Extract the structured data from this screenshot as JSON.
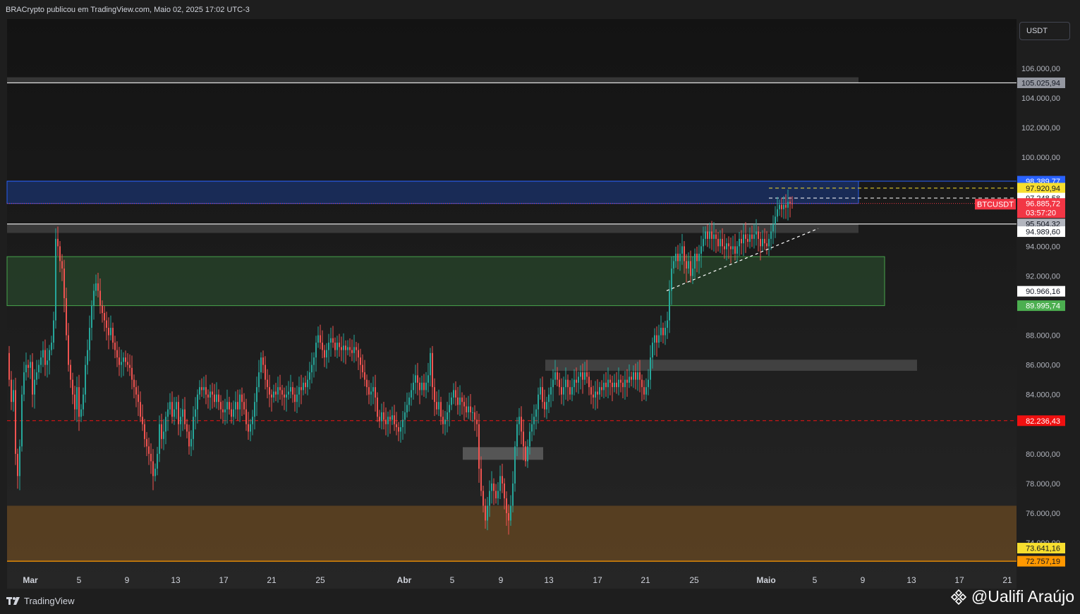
{
  "header": {
    "published_text": "BRACrypto publicou em TradingView.com, Maio 02, 2025 17:02 UTC-3"
  },
  "currency_button": "USDT",
  "footer": {
    "brand": "TradingView",
    "watermark": "@Ualifi Araújo"
  },
  "chart_data": {
    "type": "candlestick",
    "symbol": "BTCUSDT",
    "ylim": [
      72000,
      107600
    ],
    "y_ticks": [
      "106.000,00",
      "104.000,00",
      "102.000,00",
      "100.000,00",
      "94.000,00",
      "92.000,00",
      "88.000,00",
      "86.000,00",
      "84.000,00",
      "80.000,00",
      "78.000,00",
      "76.000,00",
      "74.000,00"
    ],
    "x_ticks": [
      "Mar",
      "5",
      "9",
      "13",
      "17",
      "21",
      "25",
      "Abr",
      "5",
      "9",
      "13",
      "17",
      "21",
      "25",
      "Maio",
      "5",
      "9",
      "13",
      "17",
      "21"
    ],
    "price_labels": [
      {
        "text": "105.025,94",
        "value": 105025.94,
        "bg": "#9598a1",
        "fg": "#131722"
      },
      {
        "text": "98.389,77",
        "value": 98389.77,
        "bg": "#2962ff",
        "fg": "#ffffff"
      },
      {
        "text": "97.920,94",
        "value": 97920.94,
        "bg": "#f7de2f",
        "fg": "#131722"
      },
      {
        "text": "97.248,58",
        "value": 97248.58,
        "bg": "#ffffff",
        "fg": "#131722"
      },
      {
        "text": "96.885,72",
        "value": 96885.72,
        "bg": "#f23645",
        "fg": "#ffffff"
      },
      {
        "text": "95.504,32",
        "value": 95504.32,
        "bg": "#b2b5be",
        "fg": "#131722"
      },
      {
        "text": "94.989,60",
        "value": 94989.6,
        "bg": "#ffffff",
        "fg": "#131722"
      },
      {
        "text": "90.966,16",
        "value": 90966.16,
        "bg": "#ffffff",
        "fg": "#131722"
      },
      {
        "text": "89.995,74",
        "value": 89995.74,
        "bg": "#4caf50",
        "fg": "#ffffff"
      },
      {
        "text": "82.236,43",
        "value": 82236.43,
        "bg": "#f01010",
        "fg": "#ffffff"
      },
      {
        "text": "73.641,16",
        "value": 73641.16,
        "bg": "#f7de2f",
        "fg": "#131722"
      },
      {
        "text": "72.757,19",
        "value": 72757.19,
        "bg": "#ff9800",
        "fg": "#131722"
      }
    ],
    "countdown": "03:57:20",
    "zones": [
      {
        "name": "resistance-zone",
        "from": 105400,
        "to": 105025.94,
        "color": "#3a3a3a"
      },
      {
        "name": "blue-zone",
        "from": 98389.77,
        "to": 96885.72,
        "color": "#1a2d5c"
      },
      {
        "name": "grey-zone",
        "from": 95504.32,
        "to": 94900,
        "color": "#3c3c3c"
      },
      {
        "name": "green-zone",
        "from": 93300,
        "to": 89995.74,
        "color": "#253d28"
      },
      {
        "name": "supply-zone",
        "from": 86350,
        "to": 85600,
        "color": "#444444"
      },
      {
        "name": "low-zone",
        "from": 80450,
        "to": 79600,
        "color": "#5a5a5a"
      },
      {
        "name": "brown-zone",
        "from": 76500,
        "to": 72757.19,
        "color": "#5b4122"
      }
    ],
    "series_close": [
      [
        0,
        86800
      ],
      [
        3,
        85000
      ],
      [
        6,
        83500
      ],
      [
        9,
        84300
      ],
      [
        12,
        80000
      ],
      [
        15,
        78500
      ],
      [
        18,
        80500
      ],
      [
        21,
        84000
      ],
      [
        24,
        85500
      ],
      [
        27,
        86000
      ],
      [
        30,
        85800
      ],
      [
        33,
        86200
      ],
      [
        36,
        84000
      ],
      [
        39,
        85000
      ],
      [
        42,
        85500
      ],
      [
        45,
        86000
      ],
      [
        48,
        86500
      ],
      [
        51,
        87000
      ],
      [
        54,
        86000
      ],
      [
        57,
        86300
      ],
      [
        60,
        87000
      ],
      [
        63,
        87500
      ],
      [
        66,
        89000
      ],
      [
        69,
        94500
      ],
      [
        72,
        94000
      ],
      [
        75,
        93000
      ],
      [
        78,
        92500
      ],
      [
        81,
        90500
      ],
      [
        84,
        88000
      ],
      [
        87,
        86000
      ],
      [
        90,
        85000
      ],
      [
        93,
        84000
      ],
      [
        96,
        83000
      ],
      [
        99,
        84500
      ],
      [
        102,
        82500
      ],
      [
        105,
        83000
      ],
      [
        108,
        84000
      ],
      [
        111,
        86000
      ],
      [
        114,
        87000
      ],
      [
        117,
        88500
      ],
      [
        120,
        90000
      ],
      [
        123,
        91000
      ],
      [
        126,
        91500
      ],
      [
        129,
        91000
      ],
      [
        132,
        90000
      ],
      [
        135,
        89500
      ],
      [
        138,
        89000
      ],
      [
        141,
        88500
      ],
      [
        144,
        88000
      ],
      [
        147,
        88500
      ],
      [
        150,
        87500
      ],
      [
        153,
        87000
      ],
      [
        156,
        86500
      ],
      [
        159,
        86000
      ],
      [
        162,
        86200
      ],
      [
        165,
        86500
      ],
      [
        168,
        86200
      ],
      [
        171,
        86000
      ],
      [
        174,
        85800
      ],
      [
        177,
        85000
      ],
      [
        180,
        84500
      ],
      [
        183,
        84000
      ],
      [
        186,
        83500
      ],
      [
        189,
        82500
      ],
      [
        192,
        82000
      ],
      [
        195,
        81000
      ],
      [
        198,
        80500
      ],
      [
        201,
        80000
      ],
      [
        204,
        79500
      ],
      [
        207,
        78500
      ],
      [
        210,
        79000
      ],
      [
        213,
        80000
      ],
      [
        216,
        82000
      ],
      [
        219,
        81000
      ],
      [
        222,
        81500
      ],
      [
        225,
        82500
      ],
      [
        228,
        83000
      ],
      [
        231,
        83500
      ],
      [
        234,
        82500
      ],
      [
        237,
        83000
      ],
      [
        240,
        83500
      ],
      [
        243,
        82000
      ],
      [
        246,
        82500
      ],
      [
        249,
        83000
      ],
      [
        252,
        82000
      ],
      [
        255,
        81500
      ],
      [
        258,
        80500
      ],
      [
        261,
        81000
      ],
      [
        264,
        82500
      ],
      [
        267,
        83000
      ],
      [
        270,
        84000
      ],
      [
        273,
        84500
      ],
      [
        276,
        84300
      ],
      [
        279,
        84500
      ],
      [
        282,
        84000
      ],
      [
        285,
        83800
      ],
      [
        288,
        84200
      ],
      [
        291,
        84000
      ],
      [
        294,
        83500
      ],
      [
        297,
        84000
      ],
      [
        300,
        83500
      ],
      [
        303,
        83000
      ],
      [
        306,
        82800
      ],
      [
        309,
        83000
      ],
      [
        312,
        83500
      ],
      [
        315,
        83000
      ],
      [
        318,
        82500
      ],
      [
        321,
        83000
      ],
      [
        324,
        83500
      ],
      [
        327,
        83000
      ],
      [
        330,
        84000
      ],
      [
        333,
        83500
      ],
      [
        336,
        83000
      ],
      [
        339,
        82000
      ],
      [
        342,
        81500
      ],
      [
        345,
        82000
      ],
      [
        348,
        82500
      ],
      [
        351,
        83500
      ],
      [
        354,
        84500
      ],
      [
        357,
        85500
      ],
      [
        360,
        86500
      ],
      [
        363,
        86000
      ],
      [
        366,
        85000
      ],
      [
        369,
        84500
      ],
      [
        372,
        84000
      ],
      [
        375,
        83800
      ],
      [
        378,
        84200
      ],
      [
        381,
        84000
      ],
      [
        384,
        84500
      ],
      [
        387,
        84300
      ],
      [
        390,
        84000
      ],
      [
        393,
        83800
      ],
      [
        396,
        84000
      ],
      [
        399,
        84200
      ],
      [
        402,
        84500
      ],
      [
        405,
        84000
      ],
      [
        408,
        83500
      ],
      [
        411,
        84000
      ],
      [
        414,
        84500
      ],
      [
        417,
        84300
      ],
      [
        420,
        84800
      ],
      [
        423,
        84500
      ],
      [
        426,
        85000
      ],
      [
        429,
        85500
      ],
      [
        432,
        86000
      ],
      [
        435,
        86500
      ],
      [
        438,
        87500
      ],
      [
        441,
        88000
      ],
      [
        444,
        87500
      ],
      [
        447,
        87000
      ],
      [
        450,
        86500
      ],
      [
        453,
        87000
      ],
      [
        456,
        87500
      ],
      [
        459,
        87800
      ],
      [
        462,
        87500
      ],
      [
        465,
        87000
      ],
      [
        468,
        87500
      ],
      [
        471,
        87200
      ],
      [
        474,
        87000
      ],
      [
        477,
        87300
      ],
      [
        480,
        87000
      ],
      [
        483,
        87200
      ],
      [
        486,
        87000
      ],
      [
        489,
        86800
      ],
      [
        492,
        87200
      ],
      [
        495,
        87000
      ],
      [
        498,
        86500
      ],
      [
        501,
        86000
      ],
      [
        504,
        85500
      ],
      [
        507,
        85000
      ],
      [
        510,
        84500
      ],
      [
        513,
        84000
      ],
      [
        516,
        84200
      ],
      [
        519,
        84500
      ],
      [
        522,
        83800
      ],
      [
        525,
        82500
      ],
      [
        528,
        82200
      ],
      [
        531,
        82800
      ],
      [
        534,
        82300
      ],
      [
        537,
        82000
      ],
      [
        540,
        82500
      ],
      [
        543,
        82300
      ],
      [
        546,
        82600
      ],
      [
        549,
        82000
      ],
      [
        552,
        81800
      ],
      [
        555,
        81500
      ],
      [
        558,
        81800
      ],
      [
        561,
        82300
      ],
      [
        564,
        82800
      ],
      [
        567,
        83300
      ],
      [
        570,
        83800
      ],
      [
        573,
        84300
      ],
      [
        576,
        84800
      ],
      [
        579,
        85300
      ],
      [
        582,
        84800
      ],
      [
        585,
        84300
      ],
      [
        588,
        84800
      ],
      [
        591,
        84300
      ],
      [
        594,
        84800
      ],
      [
        597,
        85300
      ],
      [
        600,
        86800
      ],
      [
        603,
        84500
      ],
      [
        606,
        83500
      ],
      [
        609,
        83000
      ],
      [
        612,
        83500
      ],
      [
        615,
        82500
      ],
      [
        618,
        82000
      ],
      [
        621,
        82300
      ],
      [
        624,
        82800
      ],
      [
        627,
        83300
      ],
      [
        630,
        83800
      ],
      [
        633,
        84300
      ],
      [
        636,
        83800
      ],
      [
        639,
        83300
      ],
      [
        642,
        83800
      ],
      [
        645,
        83500
      ],
      [
        648,
        83200
      ],
      [
        651,
        82800
      ],
      [
        654,
        83200
      ],
      [
        657,
        82800
      ],
      [
        660,
        82800
      ],
      [
        663,
        82300
      ],
      [
        666,
        82000
      ],
      [
        669,
        79000
      ],
      [
        672,
        77500
      ],
      [
        675,
        76500
      ],
      [
        678,
        75500
      ],
      [
        681,
        76500
      ],
      [
        684,
        77500
      ],
      [
        687,
        78000
      ],
      [
        690,
        77500
      ],
      [
        693,
        77000
      ],
      [
        696,
        77500
      ],
      [
        699,
        78500
      ],
      [
        702,
        78000
      ],
      [
        705,
        77000
      ],
      [
        708,
        76000
      ],
      [
        711,
        75500
      ],
      [
        714,
        76500
      ],
      [
        717,
        78000
      ],
      [
        720,
        80500
      ],
      [
        723,
        82000
      ],
      [
        726,
        82500
      ],
      [
        729,
        81500
      ],
      [
        732,
        80500
      ],
      [
        735,
        79500
      ],
      [
        738,
        80500
      ],
      [
        741,
        81500
      ],
      [
        744,
        82000
      ],
      [
        747,
        82500
      ],
      [
        750,
        83000
      ],
      [
        753,
        84000
      ],
      [
        756,
        84500
      ],
      [
        759,
        83500
      ],
      [
        762,
        83000
      ],
      [
        765,
        83500
      ],
      [
        768,
        84000
      ],
      [
        771,
        84500
      ],
      [
        774,
        85000
      ],
      [
        777,
        85500
      ],
      [
        780,
        85000
      ],
      [
        783,
        84500
      ],
      [
        786,
        84000
      ],
      [
        789,
        84500
      ],
      [
        792,
        85000
      ],
      [
        795,
        84500
      ],
      [
        798,
        84000
      ],
      [
        801,
        84500
      ],
      [
        804,
        85000
      ],
      [
        807,
        84800
      ],
      [
        810,
        85200
      ],
      [
        813,
        85500
      ],
      [
        816,
        85000
      ],
      [
        819,
        85500
      ],
      [
        822,
        85200
      ],
      [
        825,
        84500
      ],
      [
        828,
        84000
      ],
      [
        831,
        83800
      ],
      [
        834,
        84200
      ],
      [
        837,
        84000
      ],
      [
        840,
        84500
      ],
      [
        843,
        84300
      ],
      [
        846,
        84800
      ],
      [
        849,
        84500
      ],
      [
        852,
        85000
      ],
      [
        855,
        84800
      ],
      [
        858,
        84500
      ],
      [
        861,
        84800
      ],
      [
        864,
        84500
      ],
      [
        867,
        85000
      ],
      [
        870,
        84800
      ],
      [
        873,
        84500
      ],
      [
        876,
        85000
      ],
      [
        879,
        84800
      ],
      [
        882,
        85200
      ],
      [
        885,
        85000
      ],
      [
        888,
        85500
      ],
      [
        891,
        85000
      ],
      [
        894,
        85500
      ],
      [
        897,
        85000
      ],
      [
        900,
        84500
      ],
      [
        903,
        84000
      ],
      [
        906,
        84500
      ],
      [
        909,
        85000
      ],
      [
        912,
        86500
      ],
      [
        915,
        87500
      ],
      [
        918,
        88000
      ],
      [
        921,
        87500
      ],
      [
        924,
        88000
      ],
      [
        927,
        88500
      ],
      [
        930,
        88000
      ],
      [
        933,
        88500
      ],
      [
        936,
        89000
      ],
      [
        939,
        91000
      ],
      [
        942,
        92500
      ],
      [
        945,
        93000
      ],
      [
        948,
        93500
      ],
      [
        951,
        93000
      ],
      [
        954,
        93500
      ],
      [
        957,
        94000
      ],
      [
        960,
        93000
      ],
      [
        963,
        92500
      ],
      [
        966,
        93000
      ],
      [
        969,
        92000
      ],
      [
        972,
        92500
      ],
      [
        975,
        93500
      ],
      [
        978,
        93000
      ],
      [
        981,
        93500
      ],
      [
        984,
        94000
      ],
      [
        987,
        94500
      ],
      [
        990,
        95000
      ],
      [
        993,
        94500
      ],
      [
        996,
        95000
      ],
      [
        999,
        94500
      ],
      [
        1002,
        94800
      ],
      [
        1005,
        94500
      ],
      [
        1008,
        94000
      ],
      [
        1011,
        94500
      ],
      [
        1014,
        94000
      ],
      [
        1017,
        93800
      ],
      [
        1020,
        94200
      ],
      [
        1023,
        94000
      ],
      [
        1026,
        93800
      ],
      [
        1029,
        94000
      ],
      [
        1032,
        93500
      ],
      [
        1035,
        94000
      ],
      [
        1038,
        94500
      ],
      [
        1041,
        94200
      ],
      [
        1044,
        94800
      ],
      [
        1047,
        94500
      ],
      [
        1050,
        94300
      ],
      [
        1053,
        94800
      ],
      [
        1056,
        94500
      ],
      [
        1059,
        94800
      ],
      [
        1062,
        95000
      ],
      [
        1065,
        94500
      ],
      [
        1068,
        94000
      ],
      [
        1071,
        94500
      ],
      [
        1074,
        94200
      ],
      [
        1077,
        94000
      ],
      [
        1080,
        94500
      ],
      [
        1083,
        95000
      ],
      [
        1086,
        95500
      ],
      [
        1089,
        96000
      ],
      [
        1092,
        96500
      ],
      [
        1095,
        96800
      ],
      [
        1098,
        96500
      ],
      [
        1101,
        96800
      ],
      [
        1104,
        96600
      ],
      [
        1107,
        97000
      ],
      [
        1110,
        96900
      ],
      [
        1113,
        96885.72
      ]
    ],
    "projected_lines": [
      {
        "name": "trend-line",
        "from": [
          935,
          91000
        ],
        "to": [
          1150,
          95200
        ],
        "color": "#ffffff",
        "dash": "4,4"
      }
    ]
  }
}
